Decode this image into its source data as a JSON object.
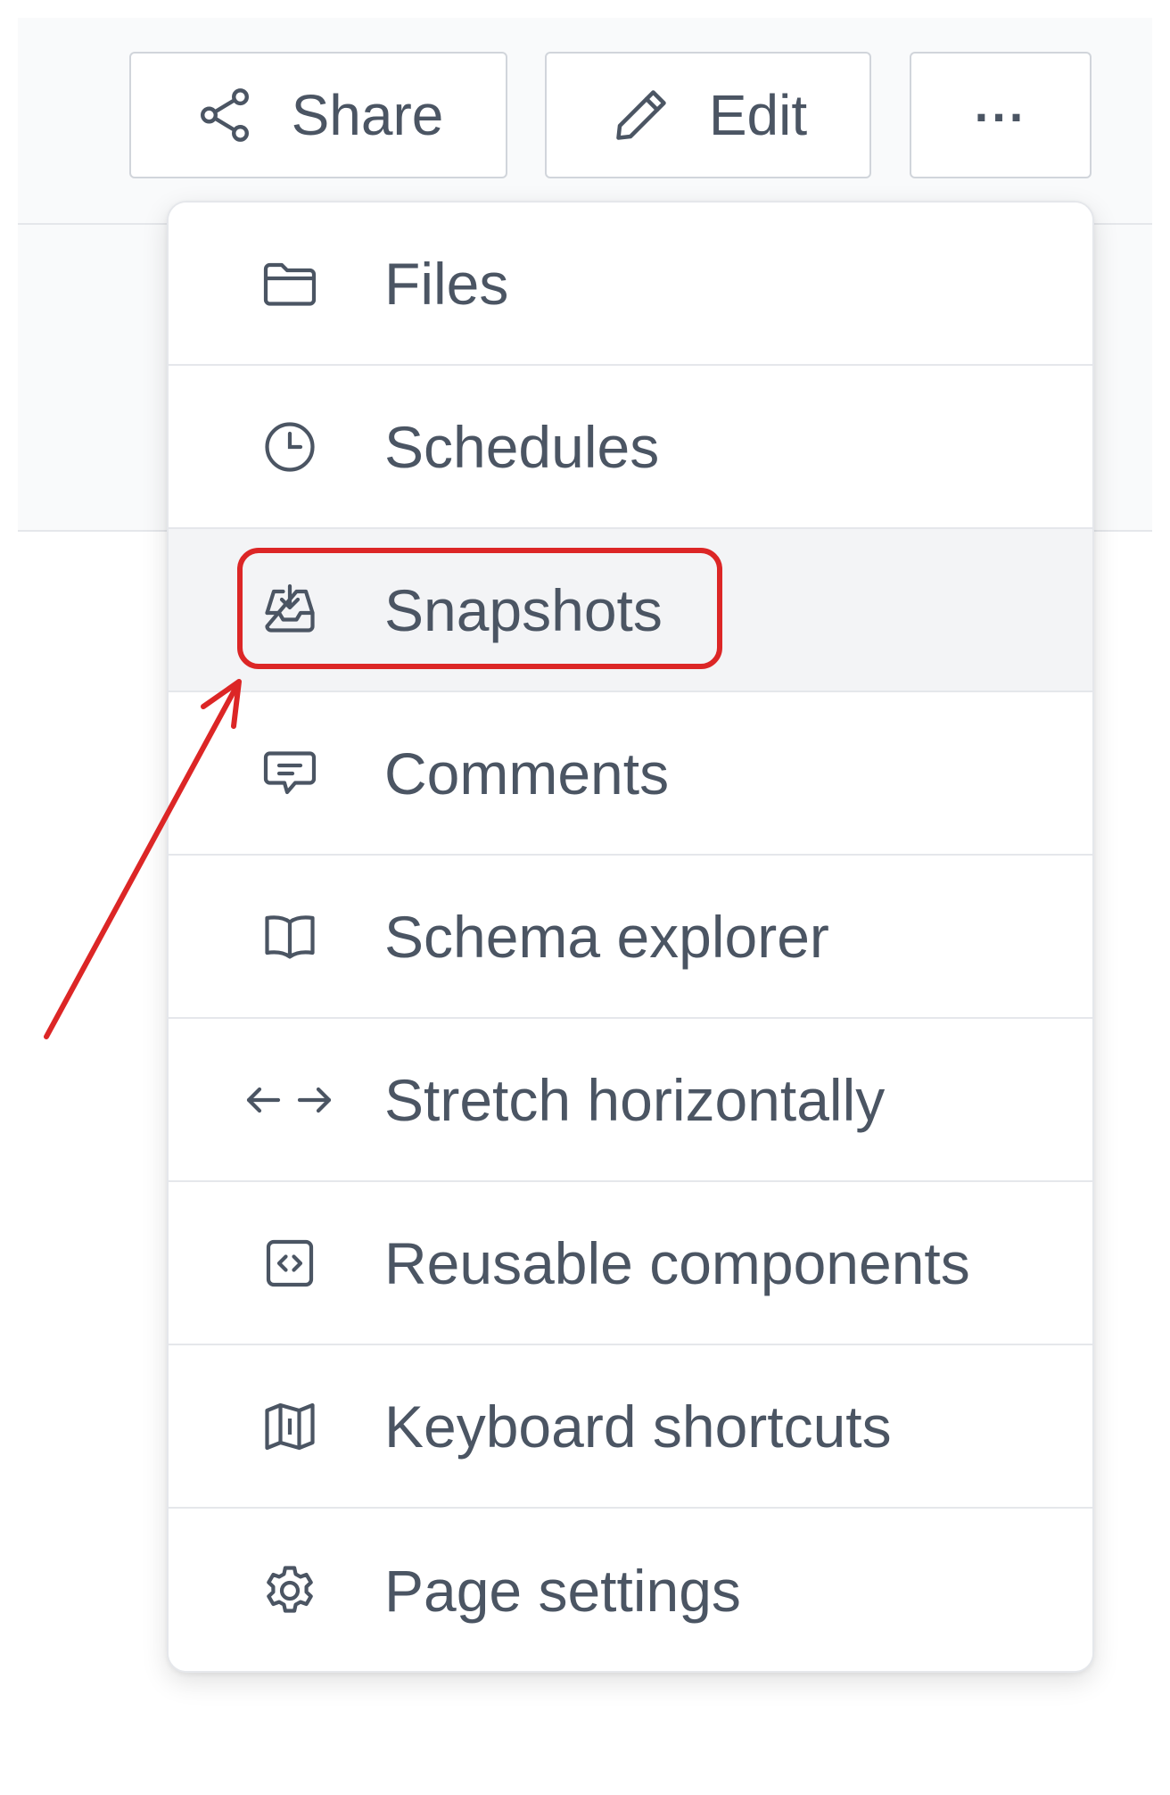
{
  "toolbar": {
    "share_label": "Share",
    "edit_label": "Edit",
    "more_label": "..."
  },
  "menu": {
    "items": [
      {
        "label": "Files",
        "icon": "folder-icon"
      },
      {
        "label": "Schedules",
        "icon": "clock-icon"
      },
      {
        "label": "Snapshots",
        "icon": "inbox-download-icon",
        "highlighted": true
      },
      {
        "label": "Comments",
        "icon": "comment-icon"
      },
      {
        "label": "Schema explorer",
        "icon": "book-open-icon"
      },
      {
        "label": "Stretch horizontally",
        "icon": "arrows-horizontal-icon"
      },
      {
        "label": "Reusable components",
        "icon": "code-square-icon"
      },
      {
        "label": "Keyboard shortcuts",
        "icon": "map-icon"
      },
      {
        "label": "Page settings",
        "icon": "gear-icon"
      }
    ]
  },
  "colors": {
    "text": "#4b5563",
    "border": "#e5e7eb",
    "active_bg": "#f3f4f6",
    "annotation": "#dc2626"
  }
}
